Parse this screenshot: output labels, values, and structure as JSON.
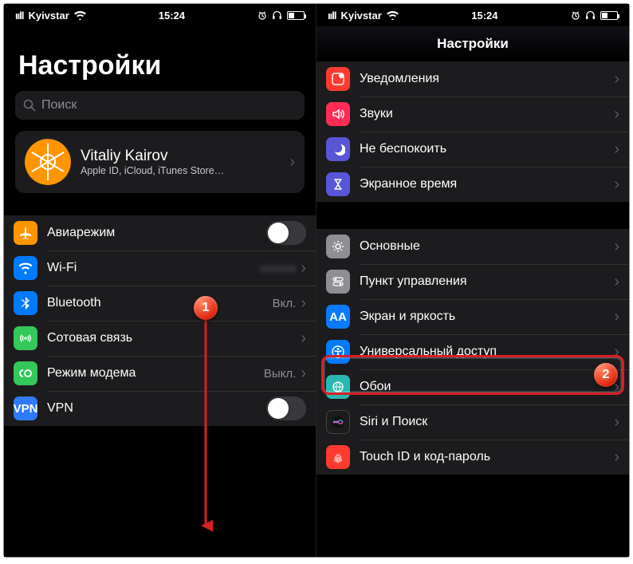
{
  "status": {
    "carrier": "Kyivstar",
    "time": "15:24",
    "signal": "ııll"
  },
  "left": {
    "title": "Настройки",
    "search_placeholder": "Поиск",
    "profile": {
      "name": "Vitaliy Kairov",
      "sub": "Apple ID, iCloud, iTunes Store…"
    },
    "rows": {
      "airplane": "Авиарежим",
      "wifi": "Wi-Fi",
      "bt": "Bluetooth",
      "bt_val": "Вкл.",
      "cell": "Сотовая связь",
      "hotspot": "Режим модема",
      "hotspot_val": "Выкл.",
      "vpn": "VPN",
      "vpn_label": "VPN"
    }
  },
  "right": {
    "nav_title": "Настройки",
    "group1": {
      "notif": "Уведомления",
      "sounds": "Звуки",
      "dnd": "Не беспокоить",
      "screen": "Экранное время"
    },
    "group2": {
      "general": "Основные",
      "control": "Пункт управления",
      "display": "Экран и яркость",
      "aa_label": "AA",
      "access": "Универсальный доступ",
      "wall": "Обои",
      "siri": "Siri и Поиск",
      "touchid": "Touch ID и код-пароль"
    }
  },
  "badges": {
    "one": "1",
    "two": "2"
  }
}
